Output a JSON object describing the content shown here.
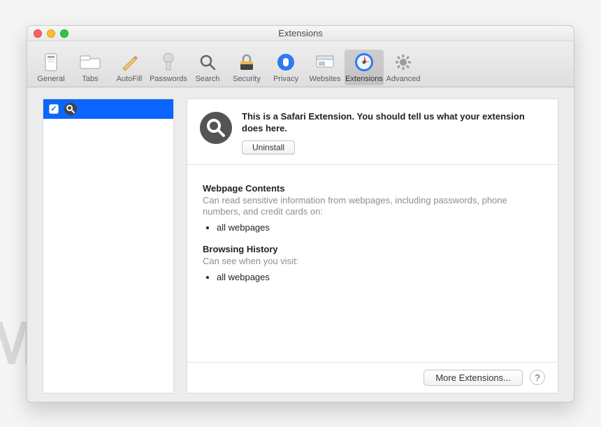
{
  "window": {
    "title": "Extensions"
  },
  "toolbar": [
    {
      "id": "general",
      "label": "General",
      "icon": "general-icon"
    },
    {
      "id": "tabs",
      "label": "Tabs",
      "icon": "tabs-icon"
    },
    {
      "id": "autofill",
      "label": "AutoFill",
      "icon": "autofill-icon"
    },
    {
      "id": "passwords",
      "label": "Passwords",
      "icon": "passwords-icon"
    },
    {
      "id": "search",
      "label": "Search",
      "icon": "search-icon"
    },
    {
      "id": "security",
      "label": "Security",
      "icon": "security-icon"
    },
    {
      "id": "privacy",
      "label": "Privacy",
      "icon": "privacy-icon"
    },
    {
      "id": "websites",
      "label": "Websites",
      "icon": "websites-icon"
    },
    {
      "id": "extensions",
      "label": "Extensions",
      "icon": "extensions-icon",
      "active": true
    },
    {
      "id": "advanced",
      "label": "Advanced",
      "icon": "advanced-icon"
    }
  ],
  "sidebar": {
    "items": [
      {
        "checked": true,
        "icon": "magnifier-icon"
      }
    ]
  },
  "detail": {
    "description": "This is a Safari Extension. You should tell us what your extension does here.",
    "uninstall_label": "Uninstall",
    "permissions": [
      {
        "title": "Webpage Contents",
        "desc": "Can read sensitive information from webpages, including passwords, phone numbers, and credit cards on:",
        "items": [
          "all webpages"
        ]
      },
      {
        "title": "Browsing History",
        "desc": "Can see when you visit:",
        "items": [
          "all webpages"
        ]
      }
    ]
  },
  "footer": {
    "more_label": "More Extensions...",
    "help_label": "?"
  },
  "watermark": "MALWARETIPS"
}
